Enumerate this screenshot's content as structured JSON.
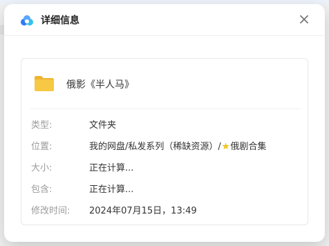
{
  "dialog": {
    "title": "详细信息",
    "brand_icon": "cloud-logo-icon",
    "close_icon": "close-icon"
  },
  "file": {
    "icon": "folder-icon",
    "name": "俄影《半人马》"
  },
  "details": [
    {
      "label": "类型:",
      "value": "文件夹"
    },
    {
      "label": "位置:",
      "value_prefix": "我的网盘/私发系列（稀缺资源）/",
      "value_icon": "star-icon",
      "value_suffix": "俄剧合集"
    },
    {
      "label": "大小:",
      "value": "正在计算..."
    },
    {
      "label": "包含:",
      "value": "正在计算..."
    },
    {
      "label": "修改时间:",
      "value": "2024年07月15日，13:49"
    }
  ],
  "colors": {
    "folder": "#f7c843",
    "folder_dark": "#eeb330",
    "label": "#9b9b9b",
    "text": "#333333"
  }
}
